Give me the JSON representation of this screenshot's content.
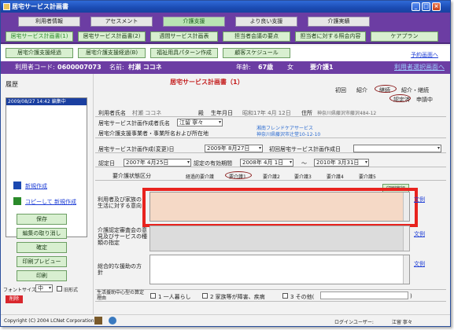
{
  "window": {
    "title": "居宅サービス計画書",
    "minimize": "_",
    "maximize": "□",
    "close": "×"
  },
  "nav_row1": [
    "利用者情報",
    "アセスメント",
    "介護支援",
    "より良い支援",
    "介護実績"
  ],
  "nav_row2": [
    "居宅サービス計画書(1)",
    "居宅サービス計画書(2)",
    "週間サービス計画表",
    "担当者会議の要点",
    "担当者に対する照会内容",
    "ケアプラン"
  ],
  "nav_row3": [
    "居宅介護支援経過",
    "居宅介護支援経過(B)",
    "福祉用具パターン作成",
    "顧客スケジュール"
  ],
  "links": {
    "schedule": "予約画面へ",
    "select_user": "利用者選択画面へ"
  },
  "userbar": {
    "code_label": "利用者コード:",
    "code_value": "0600007073",
    "name_label": "名前:",
    "name_value": "村瀬 ココネ",
    "age_label": "年齢:",
    "age_value": "67歳",
    "sex_value": "女",
    "care_label": "要介護1"
  },
  "history": {
    "title": "履歴",
    "items": [
      "2009/08/27 14:42 編集中"
    ]
  },
  "left_actions": {
    "new_create": "新規作成",
    "copy_create": "コピーして 新規作成",
    "save": "保存",
    "cancel_edit": "編集の取り消し",
    "confirm": "確定",
    "print_preview": "印刷プレビュー",
    "print": "印刷",
    "font_size_label": "フォントサイズ",
    "font_size_value": "中",
    "old_format": "旧形式",
    "delete": "削除"
  },
  "form": {
    "title": "居宅サービス計画書（1）",
    "status": {
      "initial": "初回",
      "intro": "紹介",
      "continued": "継続",
      "intro_continued": "紹介・継続",
      "certified": "認定済",
      "applying": "申請中"
    },
    "user_name_label": "利用者氏名",
    "user_name_value": "村瀬 ココネ",
    "honorific": "殿",
    "birth_label": "生年月日",
    "birth_value": "昭和17年 4月 12日",
    "address_label": "住所",
    "address_value": "神奈川県藤沢市藤沢484-12",
    "planner_label": "居宅サービス計画作成者氏名",
    "planner_value": "江留 寧々",
    "office_label": "居宅介護支援事業者・事業所名および所在地",
    "office_name": "湘南フレンドケアサービス",
    "office_address": "神奈川県藤沢市辻堂10-12-10",
    "plan_date_label": "居宅サービス計画作成(変更)日",
    "plan_date_value": "2009年 8月27日",
    "first_plan_label": "初回居宅サービス計画作成日",
    "first_plan_value": "",
    "cert_date_label": "認定日",
    "cert_date_value": "2007年 4月25日",
    "valid_label": "認定の有効期間",
    "valid_from": "2008年 4月 1日",
    "tilde": "～",
    "valid_to": "2010年 3月31日",
    "care_level_label": "要介護状態区分",
    "care_levels": [
      "経過的要介護",
      "要介護1",
      "要介護2",
      "要介護3",
      "要介護4",
      "要介護5"
    ],
    "print_label": "印刷実行",
    "intent_label": "利用者及び家族の生活に対する意向",
    "committee_label": "介護認定審査会の意見及びサービスの種類の指定",
    "policy_label": "総合的な援助の方針",
    "reason_label": "生活援助中心型の算定理由",
    "reasons": [
      "1 一人暮らし",
      "2 家族等が障害、疾病",
      "3 その他("
    ],
    "reason_close": ")",
    "bunrei": "文例"
  },
  "footer": {
    "copyright": "Copyright (C) 2004 LCNet Corporation",
    "login_label": "ログインユーザー:",
    "login_value": "江留 寧々"
  },
  "highlight_color": "#e8231e",
  "intent_field_color": "#f5d9c6"
}
